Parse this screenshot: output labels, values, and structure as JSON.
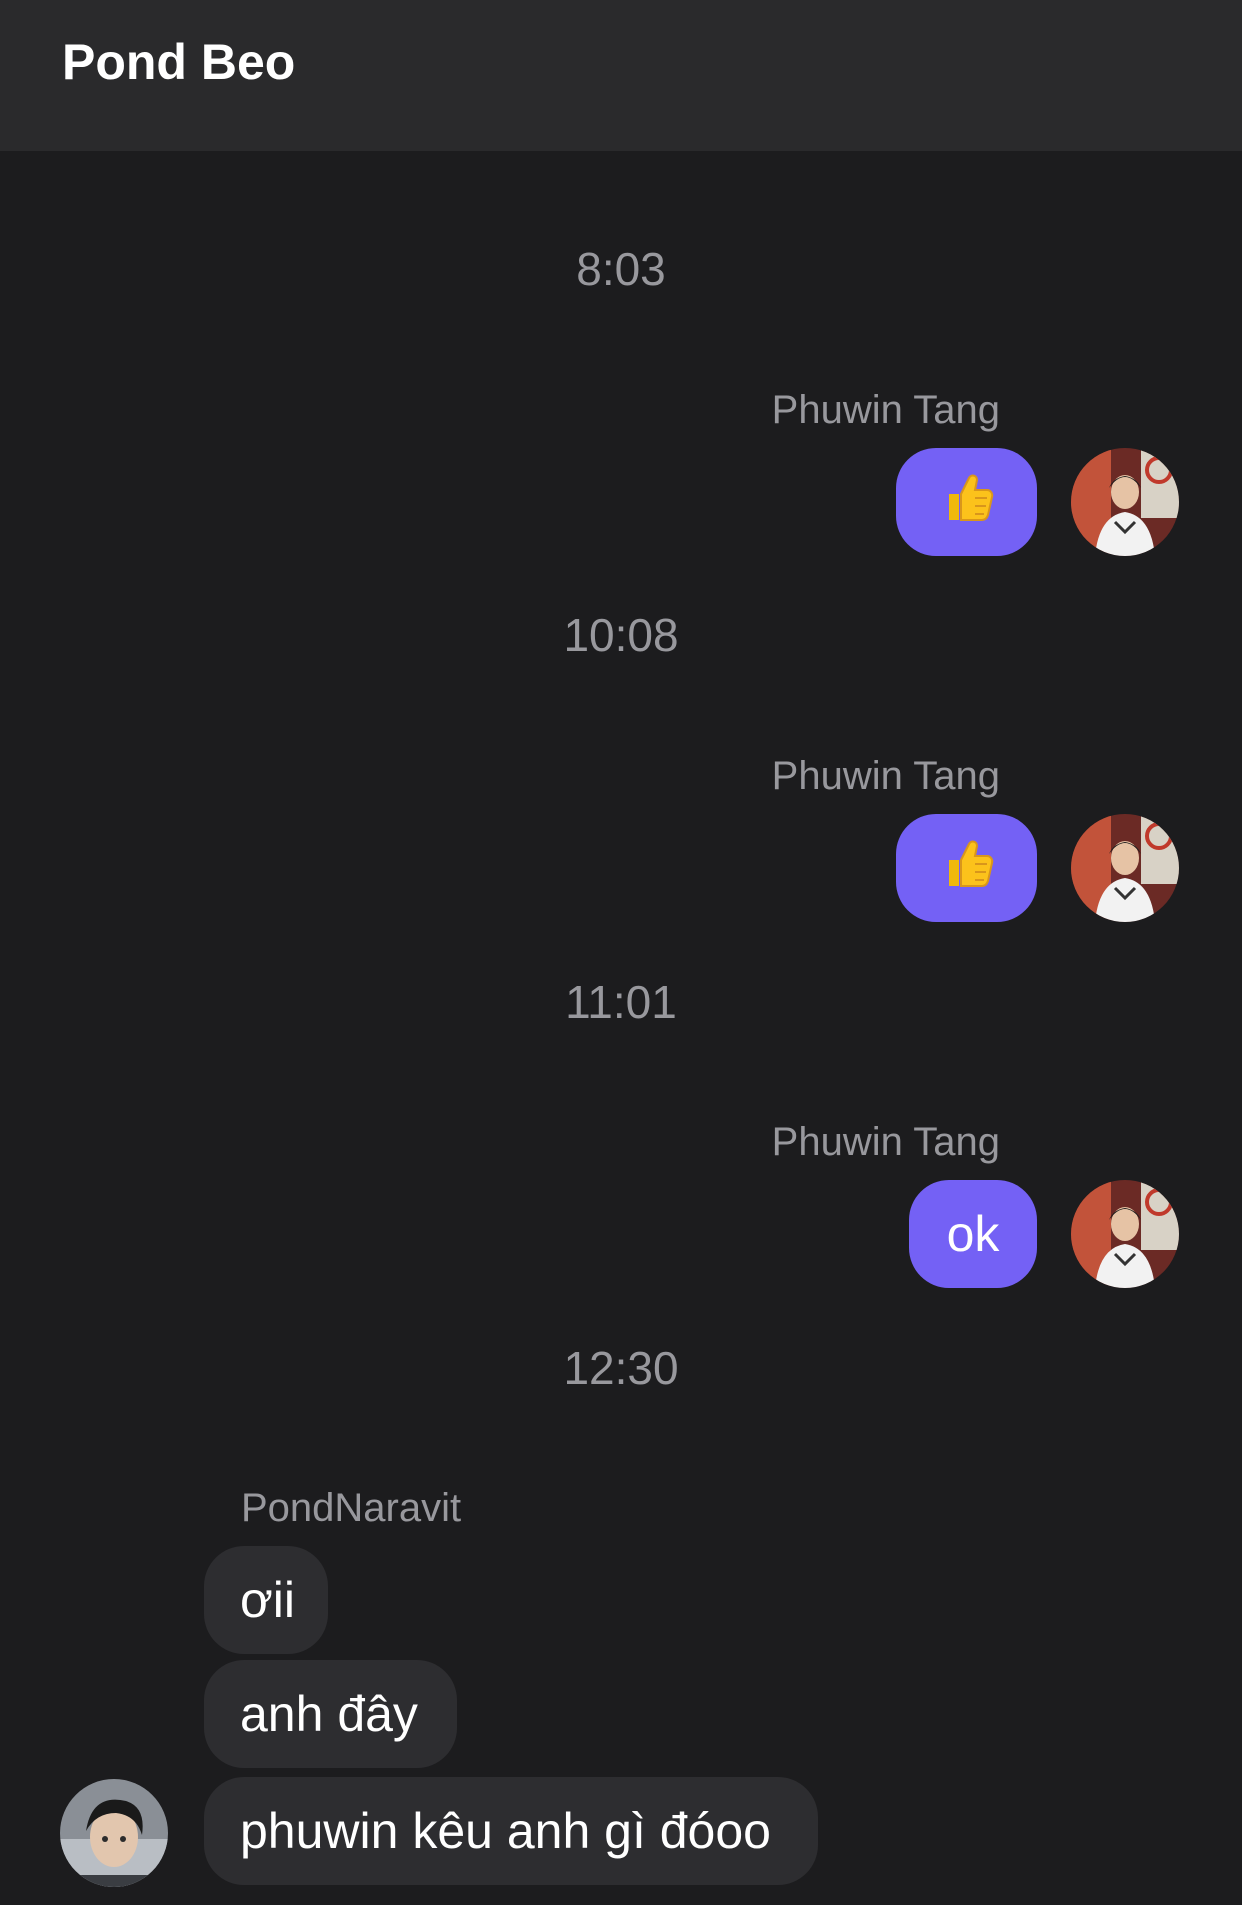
{
  "header": {
    "title": "Pond Beo"
  },
  "messages": [
    {
      "time": "8:03",
      "sender": "Phuwin Tang",
      "content": "👍",
      "kind": "thumbs-up"
    },
    {
      "time": "10:08",
      "sender": "Phuwin Tang",
      "content": "👍",
      "kind": "thumbs-up"
    },
    {
      "time": "11:01",
      "sender": "Phuwin Tang",
      "content": "ok",
      "kind": "text"
    }
  ],
  "incoming": {
    "time": "12:30",
    "sender": "PondNaravit",
    "bubbles": [
      "ơii",
      "anh đây",
      "phuwin kêu anh gì đóoo"
    ]
  },
  "colors": {
    "outgoing_bubble": "#7461f5",
    "incoming_bubble": "#2d2d30",
    "background": "#1c1c1e",
    "header": "#2a2a2c"
  }
}
